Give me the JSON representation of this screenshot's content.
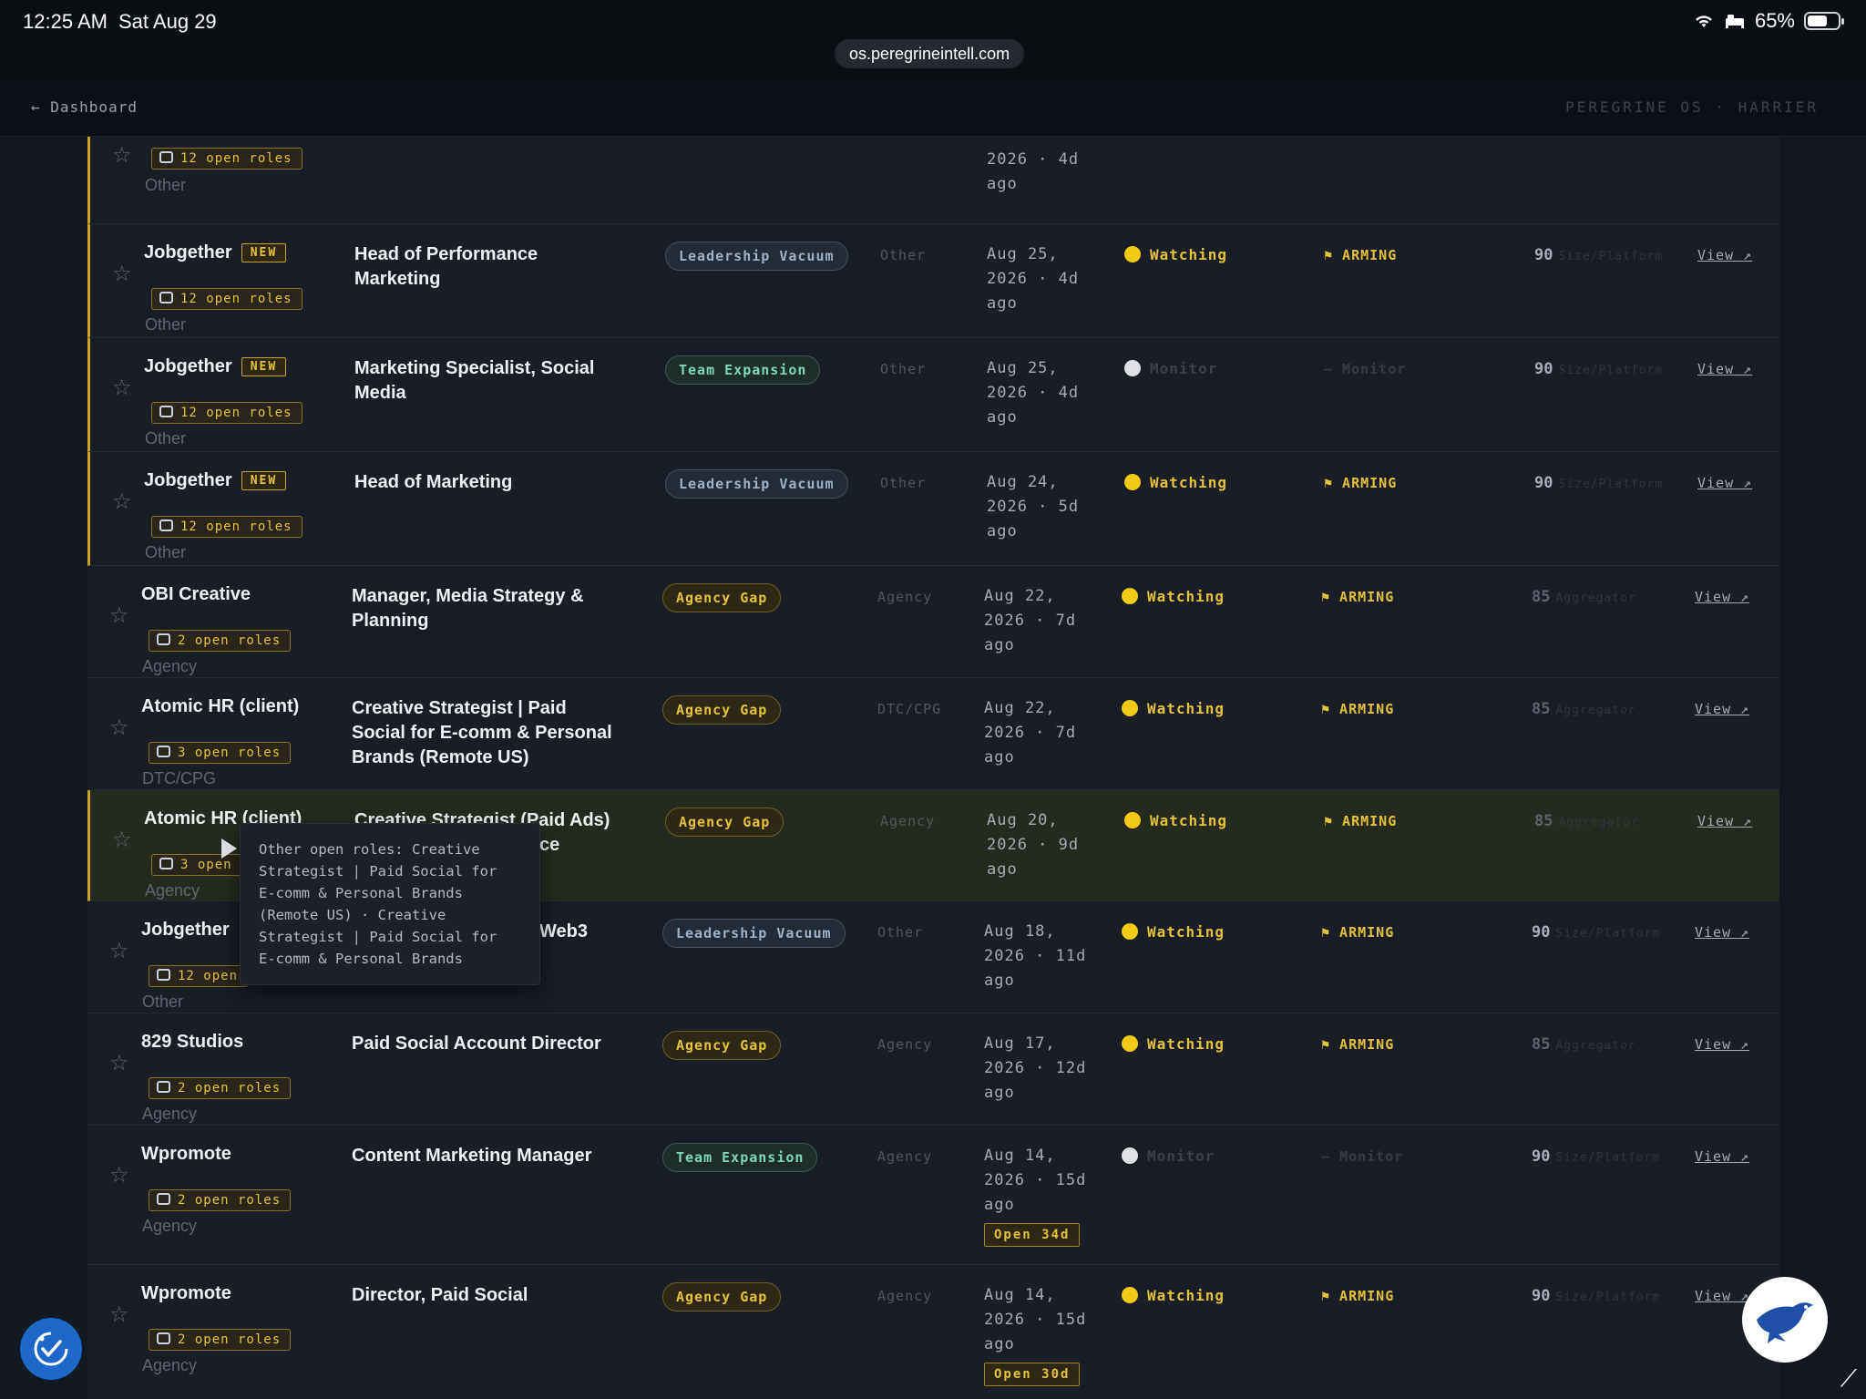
{
  "status_bar": {
    "time": "12:25 AM",
    "date": "Sat Aug 29",
    "battery": "65%",
    "battery_level": 0.65,
    "url": "os.peregrineintell.com",
    "icons": [
      "wifi-icon",
      "bed-icon",
      "battery-icon"
    ]
  },
  "header": {
    "back_label": "← Dashboard",
    "brand": "PEREGRINE OS · HARRIER"
  },
  "colors": {
    "accent_yellow": "#e4c23a",
    "watching_dot": "#f2c915",
    "agency_gap": "#e4c23a",
    "team_expansion": "#7fd6b4",
    "leadership_vacuum": "#9fb2c8",
    "fab_blue": "#1d67c8"
  },
  "rows": [
    {
      "company": "",
      "new": "",
      "roles": "12 open roles",
      "category": "Other",
      "title": "",
      "signal": "",
      "type": "",
      "date": "2026 · 4d",
      "ago": "ago",
      "open": "",
      "status": "",
      "stage": "",
      "score": "",
      "source": "",
      "view": ""
    },
    {
      "company": "Jobgether",
      "new": "NEW",
      "roles": "12 open roles",
      "category": "Other",
      "title": "Head of Performance Marketing",
      "signal": "Leadership Vacuum",
      "type": "Other",
      "date": "Aug 25, 2026 · 4d",
      "ago": "ago",
      "open": "",
      "status": "Watching",
      "stage": "⚑ ARMING",
      "score": "90",
      "source": "Size/Platform",
      "view": "View ↗"
    },
    {
      "company": "Jobgether",
      "new": "NEW",
      "roles": "12 open roles",
      "category": "Other",
      "title": "Marketing Specialist, Social Media",
      "signal": "Team Expansion",
      "type": "Other",
      "date": "Aug 25, 2026 · 4d",
      "ago": "ago",
      "open": "",
      "status": "Monitor",
      "stage": "— Monitor",
      "score": "90",
      "source": "Size/Platform",
      "view": "View ↗"
    },
    {
      "company": "Jobgether",
      "new": "NEW",
      "roles": "12 open roles",
      "category": "Other",
      "title": "Head of Marketing",
      "signal": "Leadership Vacuum",
      "type": "Other",
      "date": "Aug 24, 2026 · 5d",
      "ago": "ago",
      "open": "",
      "status": "Watching",
      "stage": "⚑ ARMING",
      "score": "90",
      "source": "Size/Platform",
      "view": "View ↗"
    },
    {
      "company": "OBI Creative",
      "new": "",
      "roles": "2 open roles",
      "category": "Agency",
      "title": "Manager, Media Strategy & Planning",
      "signal": "Agency Gap",
      "type": "Agency",
      "date": "Aug 22, 2026 · 7d",
      "ago": "ago",
      "open": "",
      "status": "Watching",
      "stage": "⚑ ARMING",
      "score": "85",
      "source": "Aggregator",
      "view": "View ↗"
    },
    {
      "company": "Atomic HR (client)",
      "new": "",
      "roles": "3 open roles",
      "category": "DTC/CPG",
      "title": "Creative Strategist | Paid Social for E-comm & Personal Brands (Remote US)",
      "signal": "Agency Gap",
      "type": "DTC/CPG",
      "date": "Aug 22, 2026 · 7d",
      "ago": "ago",
      "open": "",
      "status": "Watching",
      "stage": "⚑ ARMING",
      "score": "85",
      "source": "Aggregator",
      "view": "View ↗"
    },
    {
      "company": "Atomic HR (client)",
      "new": "",
      "roles": "3 open",
      "category": "Agency",
      "title": "Creative Strategist (Paid Ads)",
      "title_tail": "ce",
      "signal": "Agency Gap",
      "type": "Agency",
      "date": "Aug 20, 2026 · 9d",
      "ago": "ago",
      "open": "",
      "status": "Watching",
      "stage": "⚑ ARMING",
      "score": "85",
      "source": "Aggregator",
      "view": "View ↗"
    },
    {
      "company": "Jobgether",
      "new": "",
      "roles": "12 open",
      "category": "Other",
      "title": "",
      "title_tail": "Web3",
      "signal": "Leadership Vacuum",
      "type": "Other",
      "date": "Aug 18, 2026 · 11d",
      "ago": "ago",
      "open": "",
      "status": "Watching",
      "stage": "⚑ ARMING",
      "score": "90",
      "source": "Size/Platform",
      "view": "View ↗"
    },
    {
      "company": "829 Studios",
      "new": "",
      "roles": "2 open roles",
      "category": "Agency",
      "title": "Paid Social Account Director",
      "signal": "Agency Gap",
      "type": "Agency",
      "date": "Aug 17, 2026 · 12d",
      "ago": "ago",
      "open": "",
      "status": "Watching",
      "stage": "⚑ ARMING",
      "score": "85",
      "source": "Aggregator",
      "view": "View ↗"
    },
    {
      "company": "Wpromote",
      "new": "",
      "roles": "2 open roles",
      "category": "Agency",
      "title": "Content Marketing Manager",
      "signal": "Team Expansion",
      "type": "Agency",
      "date": "Aug 14, 2026 · 15d",
      "ago": "ago",
      "open": "Open 34d",
      "status": "Monitor",
      "stage": "— Monitor",
      "score": "90",
      "source": "Size/Platform",
      "view": "View ↗"
    },
    {
      "company": "Wpromote",
      "new": "",
      "roles": "2 open roles",
      "category": "Agency",
      "title": "Director, Paid Social",
      "signal": "Agency Gap",
      "type": "Agency",
      "date": "Aug 14, 2026 · 15d",
      "ago": "ago",
      "open": "Open 30d",
      "status": "Watching",
      "stage": "⚑ ARMING",
      "score": "90",
      "source": "Size/Platform",
      "view": "View ↗"
    }
  ],
  "tooltip": {
    "text": "Other open roles: Creative Strategist | Paid Social for E-comm & Personal Brands (Remote US) · Creative Strategist | Paid Social for E-comm & Personal Brands"
  }
}
